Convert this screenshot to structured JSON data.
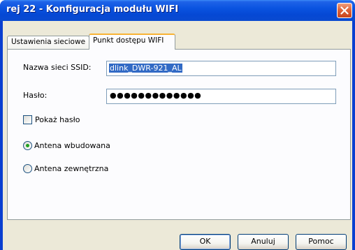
{
  "window": {
    "title": "rej 22 - Konfiguracja modułu WIFI",
    "accent_color": "#0a53e0",
    "close_icon": "close-icon"
  },
  "tabs": [
    {
      "label": "Ustawienia sieciowe",
      "active": false
    },
    {
      "label": "Punkt dostępu WIFI",
      "active": true
    }
  ],
  "form": {
    "ssid_label": "Nazwa sieci SSID:",
    "ssid_value": "dlink_DWR-921_AL",
    "password_label": "Hasło:",
    "password_value": "●●●●●●●●●●●●●",
    "show_password_label": "Pokaż hasło",
    "show_password_checked": false,
    "antenna_options": [
      {
        "label": "Antena wbudowana",
        "selected": true
      },
      {
        "label": "Antena zewnętrzna",
        "selected": false
      }
    ]
  },
  "buttons": {
    "ok": "OK",
    "cancel": "Anuluj",
    "help": "Pomoc"
  }
}
